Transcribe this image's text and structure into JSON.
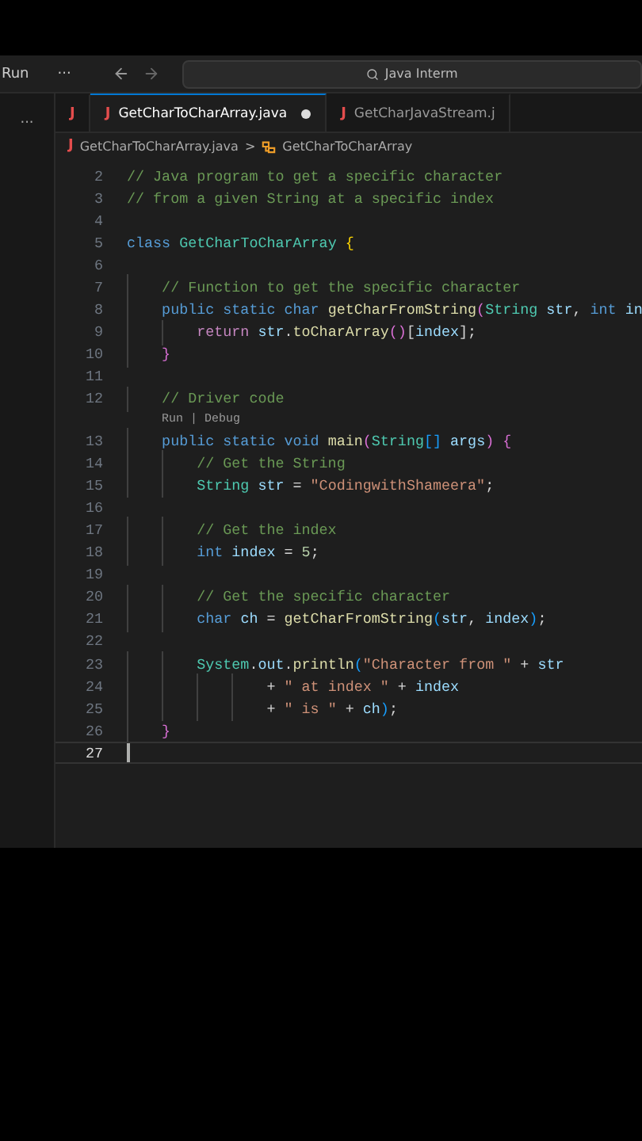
{
  "title_bar": {
    "menu": "Run",
    "more": "···",
    "search": "Java Interm"
  },
  "sidebar": {
    "more": "···"
  },
  "tabs": [
    {
      "icon": "J",
      "selected": false,
      "modified": false
    },
    {
      "icon": "J",
      "label": "GetCharToCharArray.java",
      "selected": true,
      "modified": true
    },
    {
      "icon": "J",
      "label": "GetCharJavaStream.j",
      "selected": false,
      "modified": false
    }
  ],
  "breadcrumb": {
    "icon": "J",
    "file": "GetCharToCharArray.java",
    "separator": ">",
    "symbol": "GetCharToCharArray"
  },
  "lines": [
    {
      "number": "2",
      "current": false,
      "tokens": [
        {
          "kind": "comment",
          "text": "// Java program to get a specific character"
        }
      ]
    },
    {
      "number": "3",
      "current": false,
      "tokens": [
        {
          "kind": "comment",
          "text": "// from a given String at a specific index"
        }
      ]
    },
    {
      "number": "4",
      "current": false
    },
    {
      "number": "5",
      "current": false,
      "tokens": [
        {
          "kind": "keyword",
          "text": "class "
        },
        {
          "kind": "type",
          "text": "GetCharToCharArray "
        },
        {
          "kind": "bracket",
          "text": "{"
        }
      ]
    },
    {
      "number": "6",
      "current": false
    },
    {
      "number": "7",
      "current": false,
      "tokens": [
        {
          "kind": "comment",
          "text": "    // Function to get the specific character"
        }
      ]
    },
    {
      "number": "8",
      "current": false,
      "tokens": [
        {
          "kind": "keyword",
          "text": "    public static char "
        },
        {
          "kind": "function",
          "text": "getCharFromString"
        },
        {
          "kind": "bracket2",
          "text": "("
        },
        {
          "kind": "type",
          "text": "String "
        },
        {
          "kind": "variable",
          "text": "str"
        },
        {
          "kind": "plain",
          "text": ", "
        },
        {
          "kind": "keyword",
          "text": "int "
        },
        {
          "kind": "variable",
          "text": "in"
        }
      ]
    },
    {
      "number": "9",
      "current": false,
      "tokens": [
        {
          "kind": "control",
          "text": "        return "
        },
        {
          "kind": "variable",
          "text": "str"
        },
        {
          "kind": "plain",
          "text": "."
        },
        {
          "kind": "function",
          "text": "toCharArray"
        },
        {
          "kind": "bracket2",
          "text": "()"
        },
        {
          "kind": "plain",
          "text": "["
        },
        {
          "kind": "variable",
          "text": "index"
        },
        {
          "kind": "plain",
          "text": "];"
        }
      ]
    },
    {
      "number": "10",
      "current": false,
      "tokens": [
        {
          "kind": "bracket2",
          "text": "    }"
        }
      ]
    },
    {
      "number": "11",
      "current": false
    },
    {
      "number": "12",
      "current": false,
      "tokens": [
        {
          "kind": "comment",
          "text": "    // Driver code"
        }
      ]
    },
    {
      "number": "13",
      "current": false,
      "codelens": "Run | Debug",
      "tokens": [
        {
          "kind": "keyword",
          "text": "    public static void "
        },
        {
          "kind": "function",
          "text": "main"
        },
        {
          "kind": "bracket2",
          "text": "("
        },
        {
          "kind": "type",
          "text": "String"
        },
        {
          "kind": "bracket3",
          "text": "[] "
        },
        {
          "kind": "variable",
          "text": "args"
        },
        {
          "kind": "bracket2",
          "text": ") {"
        }
      ]
    },
    {
      "number": "14",
      "current": false,
      "tokens": [
        {
          "kind": "comment",
          "text": "        // Get the String"
        }
      ]
    },
    {
      "number": "15",
      "current": false,
      "tokens": [
        {
          "kind": "type",
          "text": "        String "
        },
        {
          "kind": "variable",
          "text": "str"
        },
        {
          "kind": "plain",
          "text": " = "
        },
        {
          "kind": "string",
          "text": "\"CodingwithShameera\""
        },
        {
          "kind": "plain",
          "text": ";"
        }
      ]
    },
    {
      "number": "16",
      "current": false
    },
    {
      "number": "17",
      "current": false,
      "tokens": [
        {
          "kind": "comment",
          "text": "        // Get the index"
        }
      ]
    },
    {
      "number": "18",
      "current": false,
      "tokens": [
        {
          "kind": "keyword",
          "text": "        int "
        },
        {
          "kind": "variable",
          "text": "index"
        },
        {
          "kind": "plain",
          "text": " = "
        },
        {
          "kind": "number",
          "text": "5"
        },
        {
          "kind": "plain",
          "text": ";"
        }
      ]
    },
    {
      "number": "19",
      "current": false
    },
    {
      "number": "20",
      "current": false,
      "tokens": [
        {
          "kind": "comment",
          "text": "        // Get the specific character"
        }
      ]
    },
    {
      "number": "21",
      "current": false,
      "tokens": [
        {
          "kind": "keyword",
          "text": "        char "
        },
        {
          "kind": "variable",
          "text": "ch"
        },
        {
          "kind": "plain",
          "text": " = "
        },
        {
          "kind": "function",
          "text": "getCharFromString"
        },
        {
          "kind": "bracket3",
          "text": "("
        },
        {
          "kind": "variable",
          "text": "str"
        },
        {
          "kind": "plain",
          "text": ", "
        },
        {
          "kind": "variable",
          "text": "index"
        },
        {
          "kind": "bracket3",
          "text": ")"
        },
        {
          "kind": "plain",
          "text": ";"
        }
      ]
    },
    {
      "number": "22",
      "current": false
    },
    {
      "number": "23",
      "current": false,
      "tokens": [
        {
          "kind": "type",
          "text": "        System"
        },
        {
          "kind": "plain",
          "text": "."
        },
        {
          "kind": "variable",
          "text": "out"
        },
        {
          "kind": "plain",
          "text": "."
        },
        {
          "kind": "function",
          "text": "println"
        },
        {
          "kind": "bracket3",
          "text": "("
        },
        {
          "kind": "string",
          "text": "\"Character from \""
        },
        {
          "kind": "plain",
          "text": " + "
        },
        {
          "kind": "variable",
          "text": "str"
        }
      ]
    },
    {
      "number": "24",
      "current": false,
      "tokens": [
        {
          "kind": "plain",
          "text": "                + "
        },
        {
          "kind": "string",
          "text": "\" at index \""
        },
        {
          "kind": "plain",
          "text": " + "
        },
        {
          "kind": "variable",
          "text": "index"
        }
      ]
    },
    {
      "number": "25",
      "current": false,
      "tokens": [
        {
          "kind": "plain",
          "text": "                + "
        },
        {
          "kind": "string",
          "text": "\" is \""
        },
        {
          "kind": "plain",
          "text": " + "
        },
        {
          "kind": "variable",
          "text": "ch"
        },
        {
          "kind": "bracket3",
          "text": ")"
        },
        {
          "kind": "plain",
          "text": ";"
        }
      ]
    },
    {
      "number": "26",
      "current": false,
      "tokens": [
        {
          "kind": "bracket2",
          "text": "    }"
        }
      ]
    },
    {
      "number": "27",
      "current": true
    }
  ]
}
